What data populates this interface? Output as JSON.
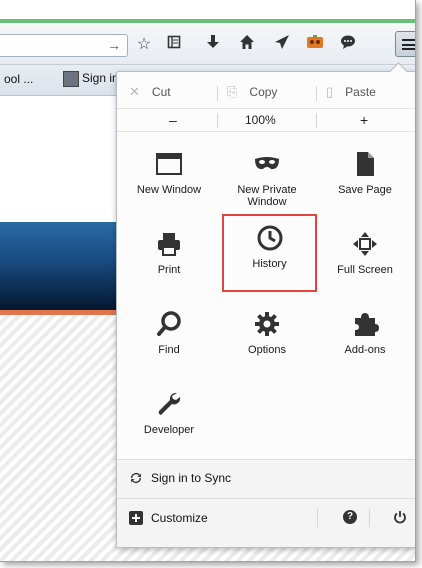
{
  "bookmarks": {
    "item1": "ool ...",
    "item2": "Sign in"
  },
  "menu": {
    "edit": {
      "cut": "Cut",
      "copy": "Copy",
      "paste": "Paste"
    },
    "zoom": {
      "minus": "–",
      "level": "100%",
      "plus": "+"
    },
    "tiles": [
      {
        "id": "new-window",
        "label": "New Window",
        "icon": "window-icon"
      },
      {
        "id": "new-private-window",
        "label": "New Private Window",
        "icon": "mask-icon"
      },
      {
        "id": "save-page",
        "label": "Save Page",
        "icon": "page-icon"
      },
      {
        "id": "print",
        "label": "Print",
        "icon": "printer-icon"
      },
      {
        "id": "history",
        "label": "History",
        "icon": "clock-icon",
        "highlighted": true
      },
      {
        "id": "full-screen",
        "label": "Full Screen",
        "icon": "fullscreen-icon"
      },
      {
        "id": "find",
        "label": "Find",
        "icon": "magnifier-icon"
      },
      {
        "id": "options",
        "label": "Options",
        "icon": "gear-icon"
      },
      {
        "id": "add-ons",
        "label": "Add-ons",
        "icon": "puzzle-icon"
      },
      {
        "id": "developer",
        "label": "Developer",
        "icon": "wrench-icon"
      }
    ],
    "sign_in": "Sign in to Sync",
    "customize": "Customize"
  },
  "colors": {
    "highlight": "#e2453f",
    "accent_green": "#64c276",
    "banner": "#1a4e84"
  }
}
